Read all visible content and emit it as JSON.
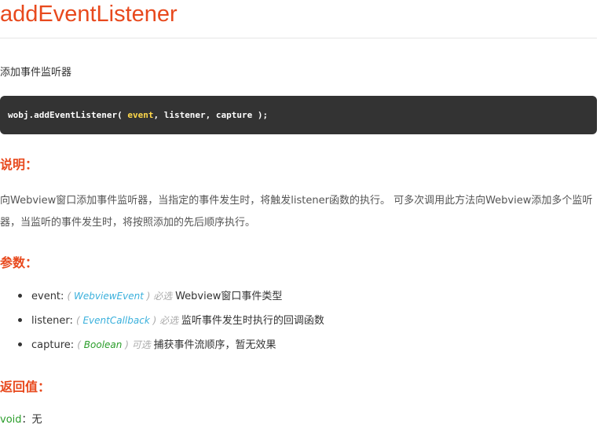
{
  "page": {
    "title": "addEventListener",
    "intro": "添加事件监听器"
  },
  "code": {
    "prefix": "wobj.addEventListener( ",
    "param1": "event",
    "rest": ", listener, capture );"
  },
  "sections": {
    "description_title": "说明：",
    "description_text": "向Webview窗口添加事件监听器，当指定的事件发生时，将触发listener函数的执行。 可多次调用此方法向Webview添加多个监听器，当监听的事件发生时，将按照添加的先后顺序执行。",
    "params_title": "参数：",
    "returns_title": "返回值："
  },
  "params": [
    {
      "name": "event: ",
      "open": "( ",
      "type": "WebviewEvent",
      "close": " )",
      "required": " 必选 ",
      "desc": "Webview窗口事件类型"
    },
    {
      "name": "listener: ",
      "open": "( ",
      "type": "EventCallback",
      "close": " )",
      "required": " 必选 ",
      "desc": "监听事件发生时执行的回调函数"
    },
    {
      "name": "capture: ",
      "open": "( ",
      "type": "Boolean",
      "close": " )",
      "required": " 可选 ",
      "desc": "捕获事件流顺序，暂无效果"
    }
  ],
  "returns": {
    "type": "void",
    "sep": "：",
    "desc": "无"
  },
  "colors": {
    "accent": "#e8491d",
    "code_bg": "#333333",
    "code_param": "#ffd84a",
    "type_blue": "#3ab0dc",
    "type_green": "#2a9d2a"
  }
}
